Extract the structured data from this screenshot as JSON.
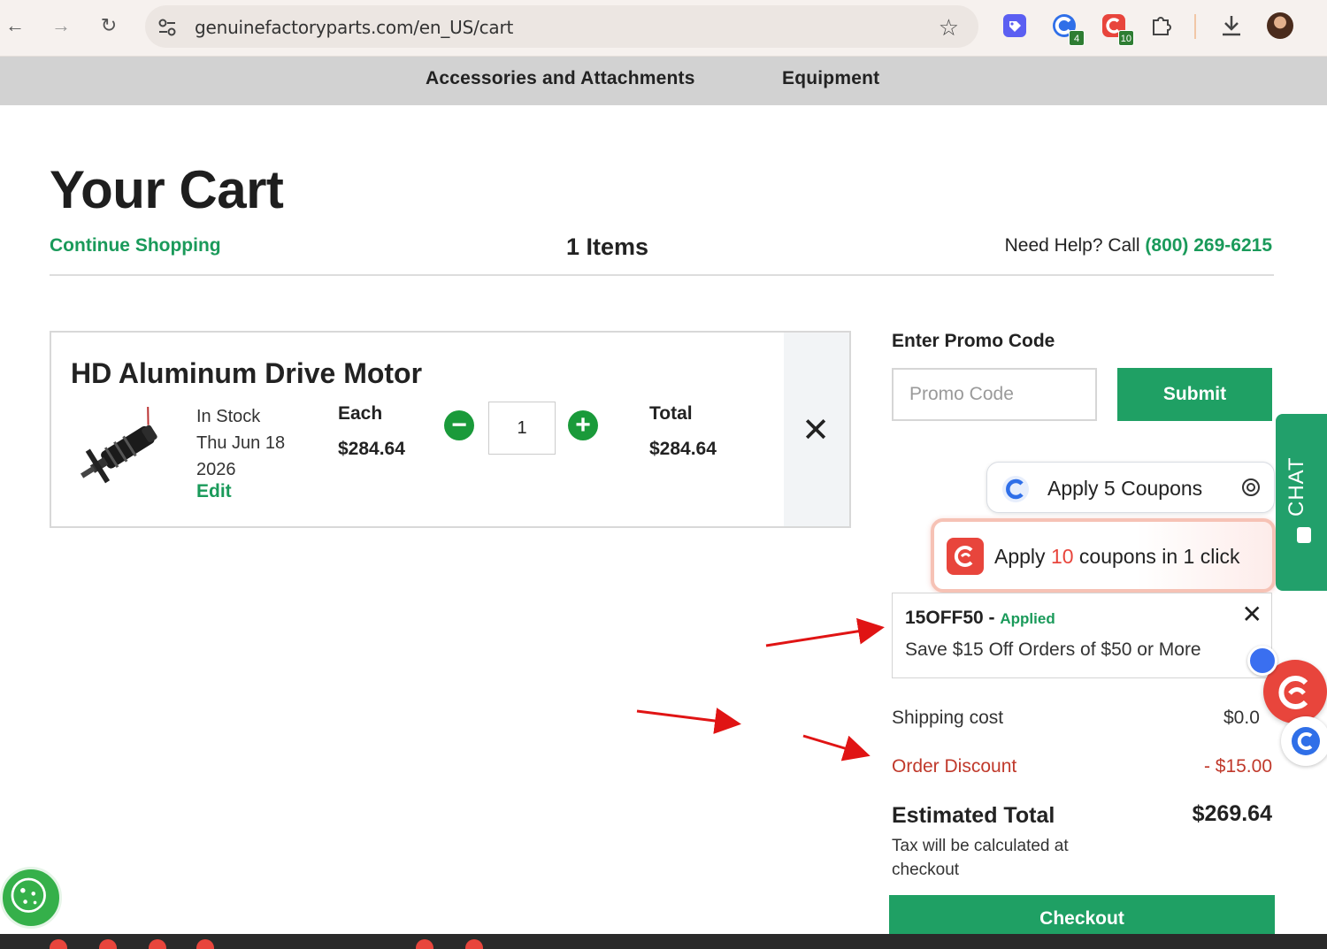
{
  "browser": {
    "url": "genuinefactoryparts.com/en_US/cart",
    "extension_badges": [
      "4",
      "10"
    ]
  },
  "site_nav": {
    "items": [
      "Accessories and Attachments",
      "Equipment"
    ]
  },
  "cart": {
    "title": "Your Cart",
    "continue_shopping": "Continue Shopping",
    "items_count": "1 Items",
    "help_prefix": "Need Help? Call ",
    "help_phone": "(800) 269-6215",
    "item": {
      "name": "HD Aluminum Drive Motor",
      "stock": "In Stock",
      "date_line1": "Thu Jun 18",
      "date_line2": "2026",
      "edit_label": "Edit",
      "each_label": "Each",
      "each_value": "$284.64",
      "quantity": "1",
      "total_label": "Total",
      "total_value": "$284.64"
    }
  },
  "promo": {
    "label": "Enter Promo Code",
    "placeholder": "Promo Code",
    "submit_label": "Submit"
  },
  "coupon_extension": {
    "label": "Apply 5 Coupons"
  },
  "capital_extension": {
    "prefix": "Apply ",
    "count": "10",
    "suffix": " coupons in 1 click"
  },
  "applied_coupon": {
    "code": "15OFF50",
    "separator": " - ",
    "status": "Applied",
    "description": "Save $15 Off Orders of $50 or More"
  },
  "summary": {
    "shipping_label": "Shipping cost",
    "shipping_value": "$0.0",
    "discount_label": "Order Discount",
    "discount_value": "- $15.00",
    "estimated_label": "Estimated Total",
    "estimated_value": "$269.64",
    "tax_note": "Tax will be calculated at checkout",
    "checkout_label": "Checkout"
  },
  "chat": {
    "label": "CHAT"
  },
  "colors": {
    "brand_green": "#1fa064",
    "link_green": "#1a9a5a",
    "discount_red": "#c0392b",
    "annotation_red": "#e01414"
  }
}
